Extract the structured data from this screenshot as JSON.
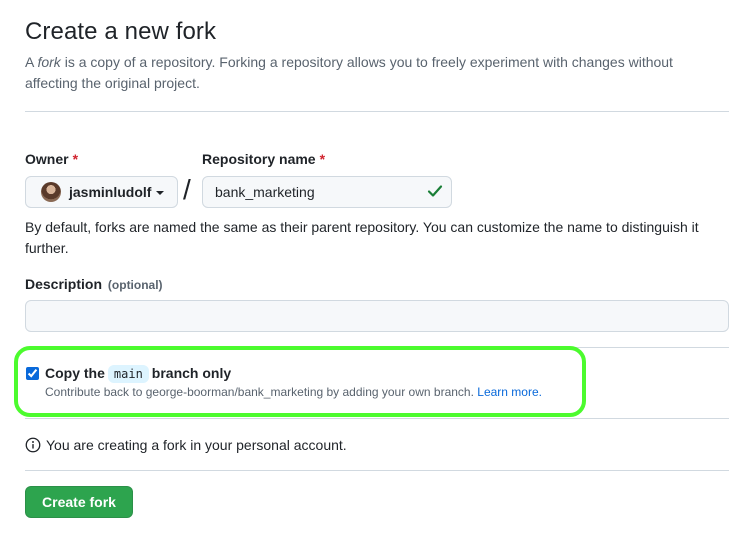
{
  "title": "Create a new fork",
  "intro": {
    "prefix": "A ",
    "fork_word": "fork",
    "text": " is a copy of a repository. Forking a repository allows you to freely experiment with changes without affecting the original project."
  },
  "owner": {
    "label": "Owner",
    "required_mark": "*",
    "value": "jasminludolf"
  },
  "separator": "/",
  "repo_name": {
    "label": "Repository name",
    "required_mark": "*",
    "value": "bank_marketing"
  },
  "help_text": "By default, forks are named the same as their parent repository. You can customize the name to distinguish it further.",
  "description": {
    "label": "Description",
    "optional": "(optional)",
    "value": ""
  },
  "copy_branch": {
    "checked": true,
    "label_prefix": "Copy the",
    "branch": "main",
    "label_suffix": "branch only",
    "note": "Contribute back to george-boorman/bank_marketing by adding your own branch.",
    "learn_more": "Learn more."
  },
  "info_text": "You are creating a fork in your personal account.",
  "create_button": "Create fork",
  "colors": {
    "primary_button": "#2da44e",
    "link": "#0969da",
    "success_check": "#1a7f37",
    "highlight": "#4cfb2e",
    "required": "#d1242f"
  }
}
